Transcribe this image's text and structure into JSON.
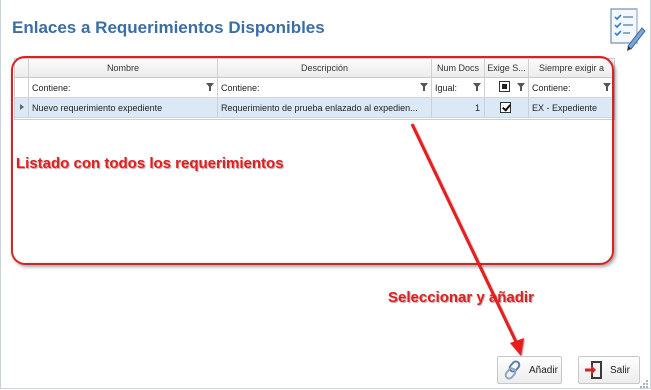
{
  "window": {
    "title": "Enlaces a Requerimientos Disponibles",
    "title_icon": "checklist-document-icon"
  },
  "grid": {
    "columns": [
      "Nombre",
      "Descripción",
      "Num Docs",
      "Exige S...",
      "Siempre exigir a"
    ],
    "filters": [
      "Contiene:",
      "Contiene:",
      "Igual:",
      "",
      "Contiene:"
    ],
    "rows": [
      {
        "nombre": "Nuevo requerimiento expediente",
        "descripcion": "Requerimiento de prueba enlazado al expedien...",
        "num_docs": "1",
        "exige": true,
        "siempre": "EX - Expediente"
      }
    ]
  },
  "annotations": {
    "list_note": "Listado con todos los requerimientos",
    "action_note": "Seleccionar y añadir",
    "color": "#e81c1c"
  },
  "buttons": {
    "add": {
      "label": "Añadir",
      "icon": "link-chain-icon"
    },
    "exit": {
      "label": "Salir",
      "icon": "exit-door-icon"
    }
  }
}
